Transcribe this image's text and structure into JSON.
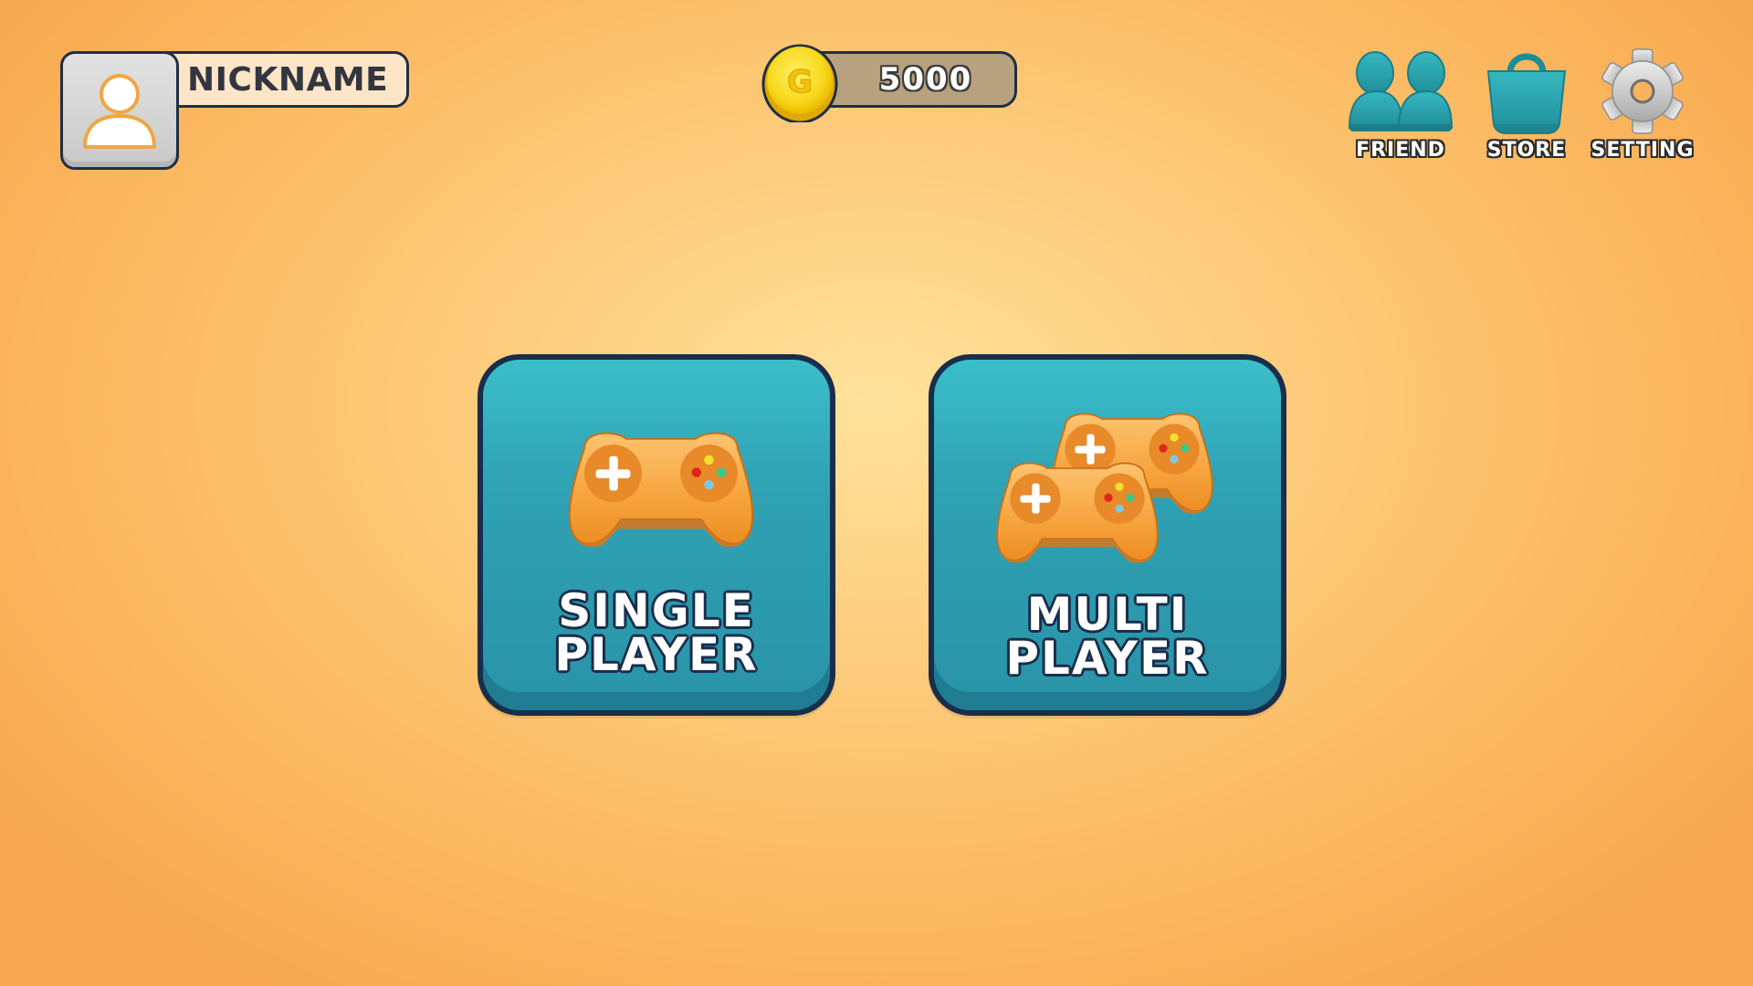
{
  "profile": {
    "nickname": "NICKNAME",
    "avatar_icon": "user-avatar-icon"
  },
  "currency": {
    "coin_icon": "gold-coin-icon",
    "coin_symbol": "G",
    "amount": "5000"
  },
  "nav": {
    "friend": {
      "label": "FRIEND",
      "icon": "friends-icon"
    },
    "store": {
      "label": "STORE",
      "icon": "shopping-bag-icon"
    },
    "setting": {
      "label": "SETTING",
      "icon": "gear-icon"
    }
  },
  "modes": {
    "single": {
      "line1": "SINGLE",
      "line2": "PLAYER",
      "icon": "gamepad-icon"
    },
    "multi": {
      "line1": "MULTI",
      "line2": "PLAYER",
      "icon": "two-gamepads-icon"
    }
  },
  "colors": {
    "background": "#fcc06a",
    "card": "#2fa2b4",
    "outline": "#1a2d4b",
    "gamepad": "#f5a33a",
    "coin": "#f8d61a"
  }
}
